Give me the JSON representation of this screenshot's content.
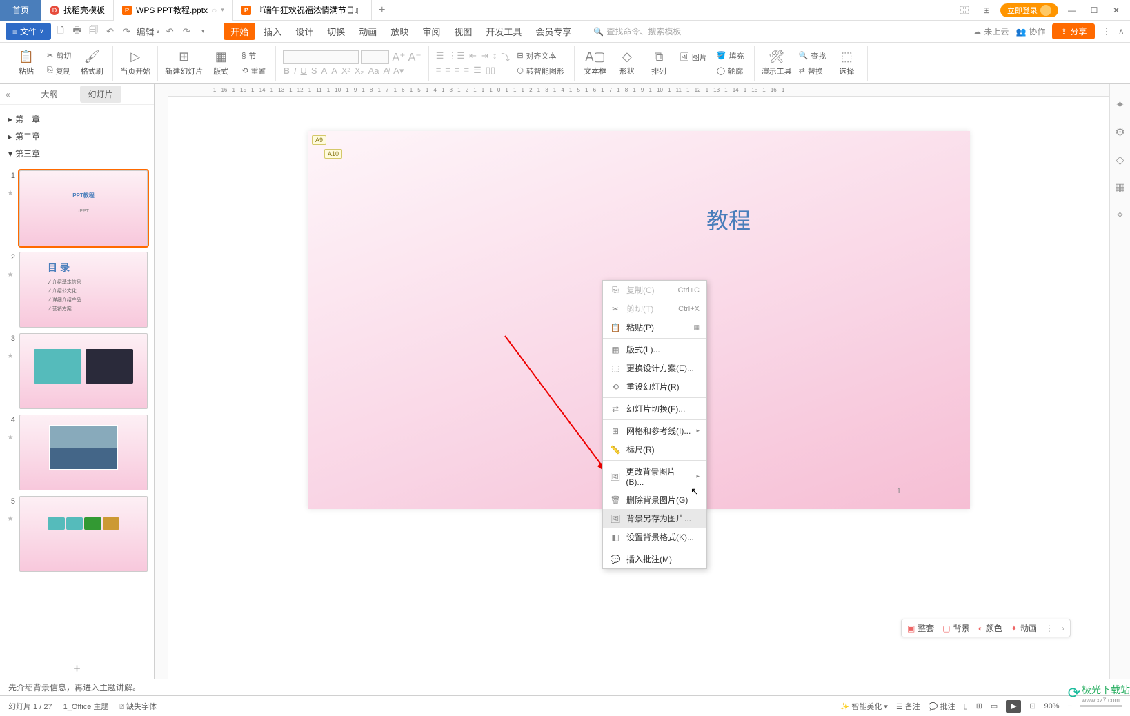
{
  "titlebar": {
    "home": "首页",
    "tabs": [
      {
        "label": "找稻壳模板",
        "type": "d"
      },
      {
        "label": "WPS PPT教程.pptx",
        "type": "p",
        "active": true
      },
      {
        "label": "『端午狂欢祝福浓情满节日』",
        "type": "p"
      }
    ],
    "login": "立即登录"
  },
  "menubar": {
    "file": "文件",
    "edit": "编辑",
    "items": [
      "开始",
      "插入",
      "设计",
      "切换",
      "动画",
      "放映",
      "审阅",
      "视图",
      "开发工具",
      "会员专享"
    ],
    "active_index": 0,
    "search_placeholder": "查找命令、搜索模板",
    "cloud": "未上云",
    "collab": "协作",
    "share": "分享"
  },
  "ribbon": {
    "paste": "粘贴",
    "cut": "剪切",
    "copy": "复制",
    "format_painter": "格式刷",
    "from_current": "当页开始",
    "new_slide": "新建幻灯片",
    "layout": "版式",
    "section": "节",
    "reset": "重置",
    "text_box": "文本框",
    "shape": "形状",
    "arrange": "排列",
    "picture": "图片",
    "fill": "填充",
    "outline": "轮廓",
    "tools": "演示工具",
    "find": "查找",
    "replace": "替换",
    "select": "选择",
    "align_text": "对齐文本",
    "convert_smartart": "转智能图形"
  },
  "panel": {
    "outline": "大纲",
    "slides": "幻灯片",
    "chapters": [
      "第一章",
      "第二章",
      "第三章"
    ]
  },
  "thumbs": {
    "t1_title": "PPT教程",
    "t1_sub": "·PPT",
    "t2_title": "目录",
    "t2_items": [
      "✓ 介绍基本信息",
      "✓ 介绍公文化",
      "✓ 详细介绍产品",
      "✓ 营销方案"
    ]
  },
  "canvas": {
    "badge1": "A9",
    "badge2": "A10",
    "text": "教程",
    "pagenum": "1",
    "ruler": "· 1 · 16 · 1 · 15 · 1 · 14 · 1 · 13 · 1 · 12 · 1 · 11 · 1 · 10 · 1 · 9 · 1 · 8 · 1 · 7 · 1 · 6 · 1 · 5 · 1 · 4 · 1 · 3 · 1 · 2 · 1 · 1 · 1 · 0 · 1 · 1 · 1 · 2 · 1 · 3 · 1 · 4 · 1 · 5 · 1 · 6 · 1 · 7 · 1 · 8 · 1 · 9 · 1 · 10 · 1 · 11 · 1 · 12 · 1 · 13 · 1 · 14 · 1 · 15 · 1 · 16 · 1"
  },
  "context_menu": {
    "copy": "复制(C)",
    "copy_key": "Ctrl+C",
    "cut": "剪切(T)",
    "cut_key": "Ctrl+X",
    "paste": "粘贴(P)",
    "layout": "版式(L)...",
    "change_design": "更换设计方案(E)...",
    "reset_slide": "重设幻灯片(R)",
    "slide_transition": "幻灯片切换(F)...",
    "grid_guides": "网格和参考线(I)...",
    "ruler": "标尺(R)",
    "change_bg": "更改背景图片(B)...",
    "delete_bg": "删除背景图片(G)",
    "save_bg": "背景另存为图片...",
    "format_bg": "设置背景格式(K)...",
    "insert_comment": "插入批注(M)"
  },
  "floatbar": {
    "suite": "整套",
    "background": "背景",
    "color": "颜色",
    "animation": "动画"
  },
  "notes": "先介绍背景信息，再进入主题讲解。",
  "statusbar": {
    "slide_info": "幻灯片 1 / 27",
    "theme": "1_Office 主题",
    "missing_font": "缺失字体",
    "beautify": "智能美化",
    "notes": "备注",
    "comments": "批注",
    "zoom": "90%"
  },
  "watermark": {
    "name": "极光下载站",
    "url": "www.xz7.com"
  }
}
